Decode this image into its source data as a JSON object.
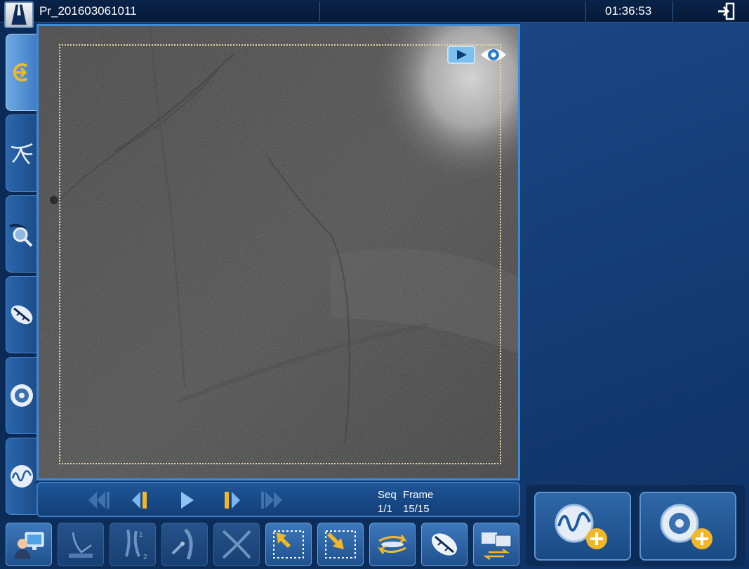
{
  "app": {
    "patient_id": "Pr_201603061011",
    "clock": "01:36:53"
  },
  "icons": {
    "logo": "brand-logo-icon",
    "exit": "exit-icon",
    "rail": [
      "acquisition-icon",
      "vessel-tree-icon",
      "magnify-icon",
      "stent-icon",
      "target-icon",
      "waveform-icon"
    ],
    "toolbar": [
      "patient-monitor-icon",
      "catheter-icon",
      "vessel-compare-icon",
      "stent-vessel-icon",
      "cross-icon",
      "roi-top-left-icon",
      "roi-bottom-right-icon",
      "swap-arrows-icon",
      "stent-enhance-icon",
      "dual-display-icon"
    ],
    "add": [
      "add-waveform-icon",
      "add-target-icon"
    ]
  },
  "playback": {
    "seq_label": "Seq",
    "frame_label": "Frame",
    "seq_value": "1/1",
    "frame_value": "15/15"
  },
  "compare_labels": {
    "top": "1",
    "bottom": "2"
  },
  "colors": {
    "accent": "#3f8ad8",
    "play_yellow": "#f2b728",
    "roi_dots": "#e9d9a6"
  }
}
